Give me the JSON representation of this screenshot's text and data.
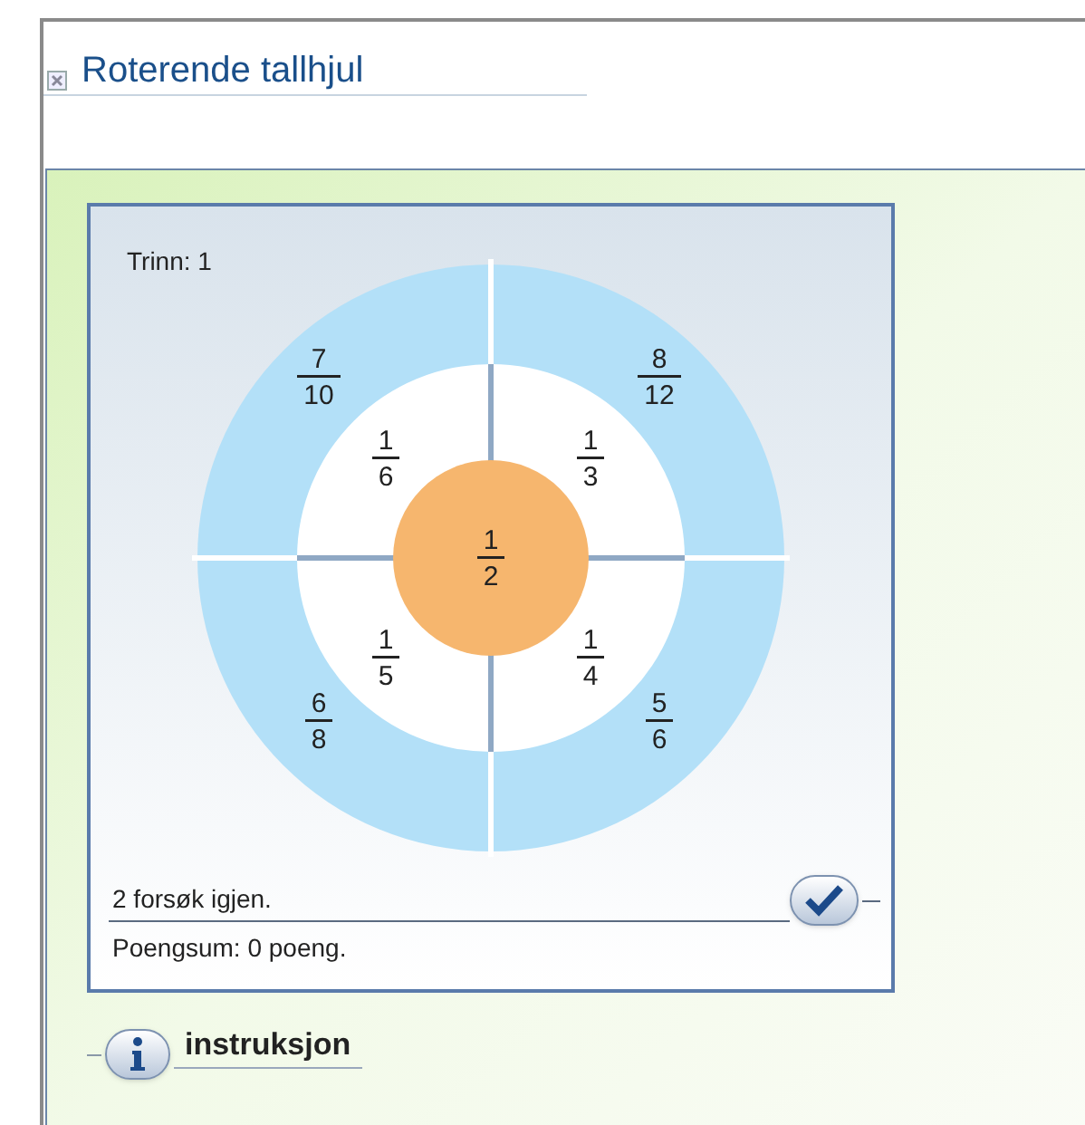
{
  "window": {
    "title": "Roterende tallhjul"
  },
  "card": {
    "level_label": "Trinn: 1",
    "wheel": {
      "outer": [
        {
          "numerator": "7",
          "denominator": "10"
        },
        {
          "numerator": "8",
          "denominator": "12"
        },
        {
          "numerator": "6",
          "denominator": "8"
        },
        {
          "numerator": "5",
          "denominator": "6"
        }
      ],
      "middle": [
        {
          "numerator": "1",
          "denominator": "6"
        },
        {
          "numerator": "1",
          "denominator": "3"
        },
        {
          "numerator": "1",
          "denominator": "5"
        },
        {
          "numerator": "1",
          "denominator": "4"
        }
      ],
      "center": {
        "numerator": "1",
        "denominator": "2"
      }
    },
    "attempts": "2 forsøk igjen.",
    "score": "Poengsum: 0 poeng."
  },
  "instructions": {
    "label": "instruksjon"
  }
}
